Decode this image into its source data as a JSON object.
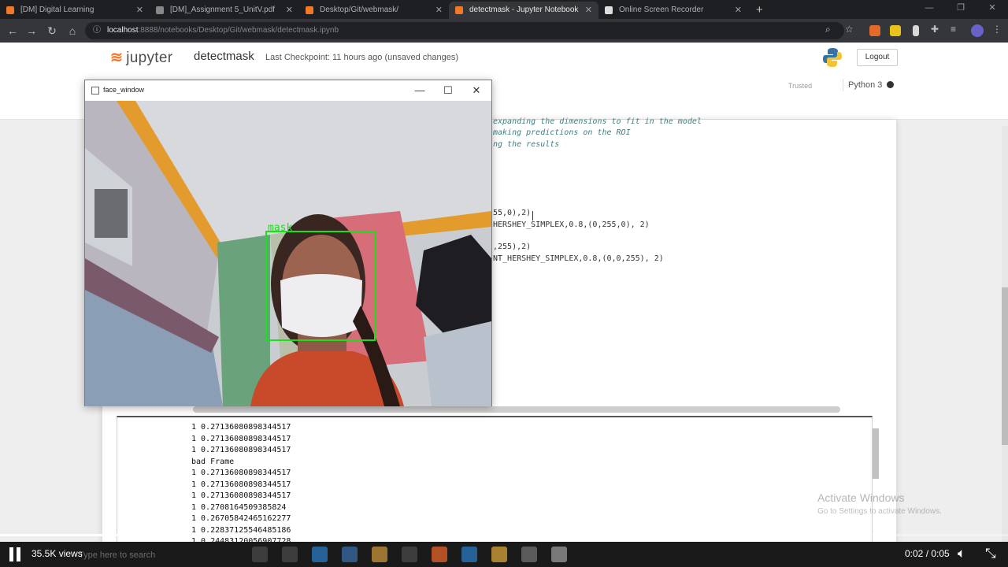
{
  "browser": {
    "tabs": [
      {
        "label": "[DM] Digital Learning",
        "favicon_color": "#f37726"
      },
      {
        "label": "[DM]_Assignment 5_UnitV.pdf",
        "favicon_color": "#888888"
      },
      {
        "label": "Desktop/Git/webmask/",
        "favicon_color": "#f37726"
      },
      {
        "label": "detectmask - Jupyter Notebook",
        "favicon_color": "#f37726"
      },
      {
        "label": "Online Screen Recorder",
        "favicon_color": "#dddddd"
      }
    ],
    "new_tab": "+",
    "url_host": "localhost",
    "url_path": ":8888/notebooks/Desktop/Git/webmask/detectmask.ipynb"
  },
  "jupyter": {
    "logo_text": "jupyter",
    "notebook_name": "detectmask",
    "checkpoint": "Last Checkpoint: 11 hours ago  (unsaved changes)",
    "logout": "Logout",
    "trusted": "Trusted",
    "kernel": "Python 3"
  },
  "code_lines": [
    "expanding the dimensions to fit in the model",
    "making predictions on the ROI",
    "ng the results",
    "55,0),2)",
    "HERSHEY_SIMPLEX,0.8,(0,255,0), 2)",
    ",255),2)",
    "NT_HERSHEY_SIMPLEX,0.8,(0,0,255), 2)"
  ],
  "output_lines": [
    "1 0.27136080898344517",
    "1 0.27136080898344517",
    "1 0.27136080898344517",
    "bad Frame",
    "1 0.27136080898344517",
    "1 0.27136080898344517",
    "1 0.27136080898344517",
    "1 0.2708164509385824",
    "1 0.26705842465162277",
    "1 0.22837125546485186",
    "1 0.24483120056907728"
  ],
  "cv_window": {
    "title": "face_window",
    "label": "mask",
    "box_color": "#19e019"
  },
  "watermark": {
    "title": "Activate Windows",
    "subtitle": "Go to Settings to activate Windows."
  },
  "player": {
    "views": "35.5K views",
    "search_hint": "Type here to search",
    "time": "0:02 / 0:05",
    "progress_fraction": 0.4
  }
}
